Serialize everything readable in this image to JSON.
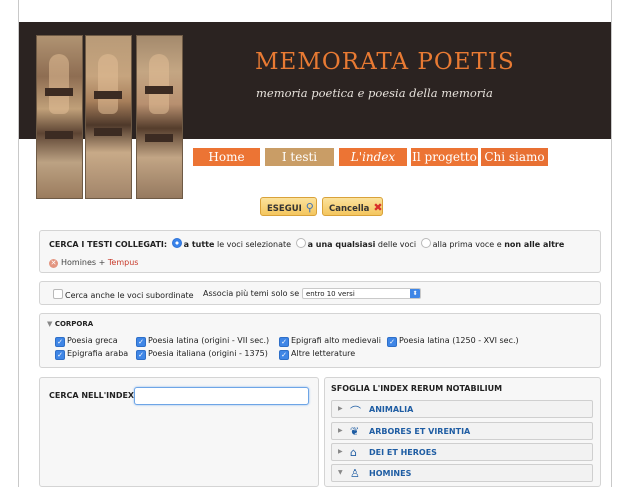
{
  "site": {
    "title": "MEMORATA POETIS",
    "subtitle": "memoria poetica e poesia della memoria"
  },
  "nav": [
    {
      "label": "Home"
    },
    {
      "label": "I testi"
    },
    {
      "label": "L'index"
    },
    {
      "label": "Il progetto"
    },
    {
      "label": "Chi siamo"
    }
  ],
  "buttons": {
    "esegui": "ESEGUI",
    "cancella": "Cancella"
  },
  "search_panel": {
    "heading": "CERCA I TESTI COLLEGATI:",
    "options": [
      {
        "bold": "a tutte",
        "rest": "le voci selezionate",
        "selected": true
      },
      {
        "bold": "a una qualsiasi",
        "rest": "delle voci",
        "selected": false
      },
      {
        "bold": "",
        "rest": "alla prima voce e",
        "bold2": "non alle altre",
        "selected": false
      }
    ],
    "tag_term1": "Homines",
    "tag_plus": "+",
    "tag_term2": "Tempus"
  },
  "options_row": {
    "subordinate_label": "Cerca anche le voci subordinate",
    "associa_label": "Associa più temi solo se si trovano:",
    "select_value": "entro 10 versi"
  },
  "corpora": {
    "heading": "CORPORA",
    "items": [
      {
        "label": "Poesia greca",
        "checked": true
      },
      {
        "label": "Poesia latina (origini - VII sec.)",
        "checked": true
      },
      {
        "label": "Epigrafi alto medievali",
        "checked": true
      },
      {
        "label": "Poesia latina (1250 - XVI sec.)",
        "checked": true
      },
      {
        "label": "Epigrafia araba",
        "checked": true
      },
      {
        "label": "Poesia italiana (origini - 1375)",
        "checked": true
      },
      {
        "label": "Altre letterature",
        "checked": true
      }
    ]
  },
  "index_search": {
    "label": "CERCA NELL'INDEX",
    "value": ""
  },
  "browse": {
    "heading": "SFOGLIA L'INDEX RERUM NOTABILIUM",
    "categories": [
      {
        "label": "ANIMALIA",
        "icon": "dolphin-icon",
        "expanded": false
      },
      {
        "label": "ARBORES ET VIRENTIA",
        "icon": "plant-icon",
        "expanded": false
      },
      {
        "label": "DEI ET HEROES",
        "icon": "temple-icon",
        "expanded": false
      },
      {
        "label": "HOMINES",
        "icon": "person-icon",
        "expanded": true
      }
    ]
  }
}
